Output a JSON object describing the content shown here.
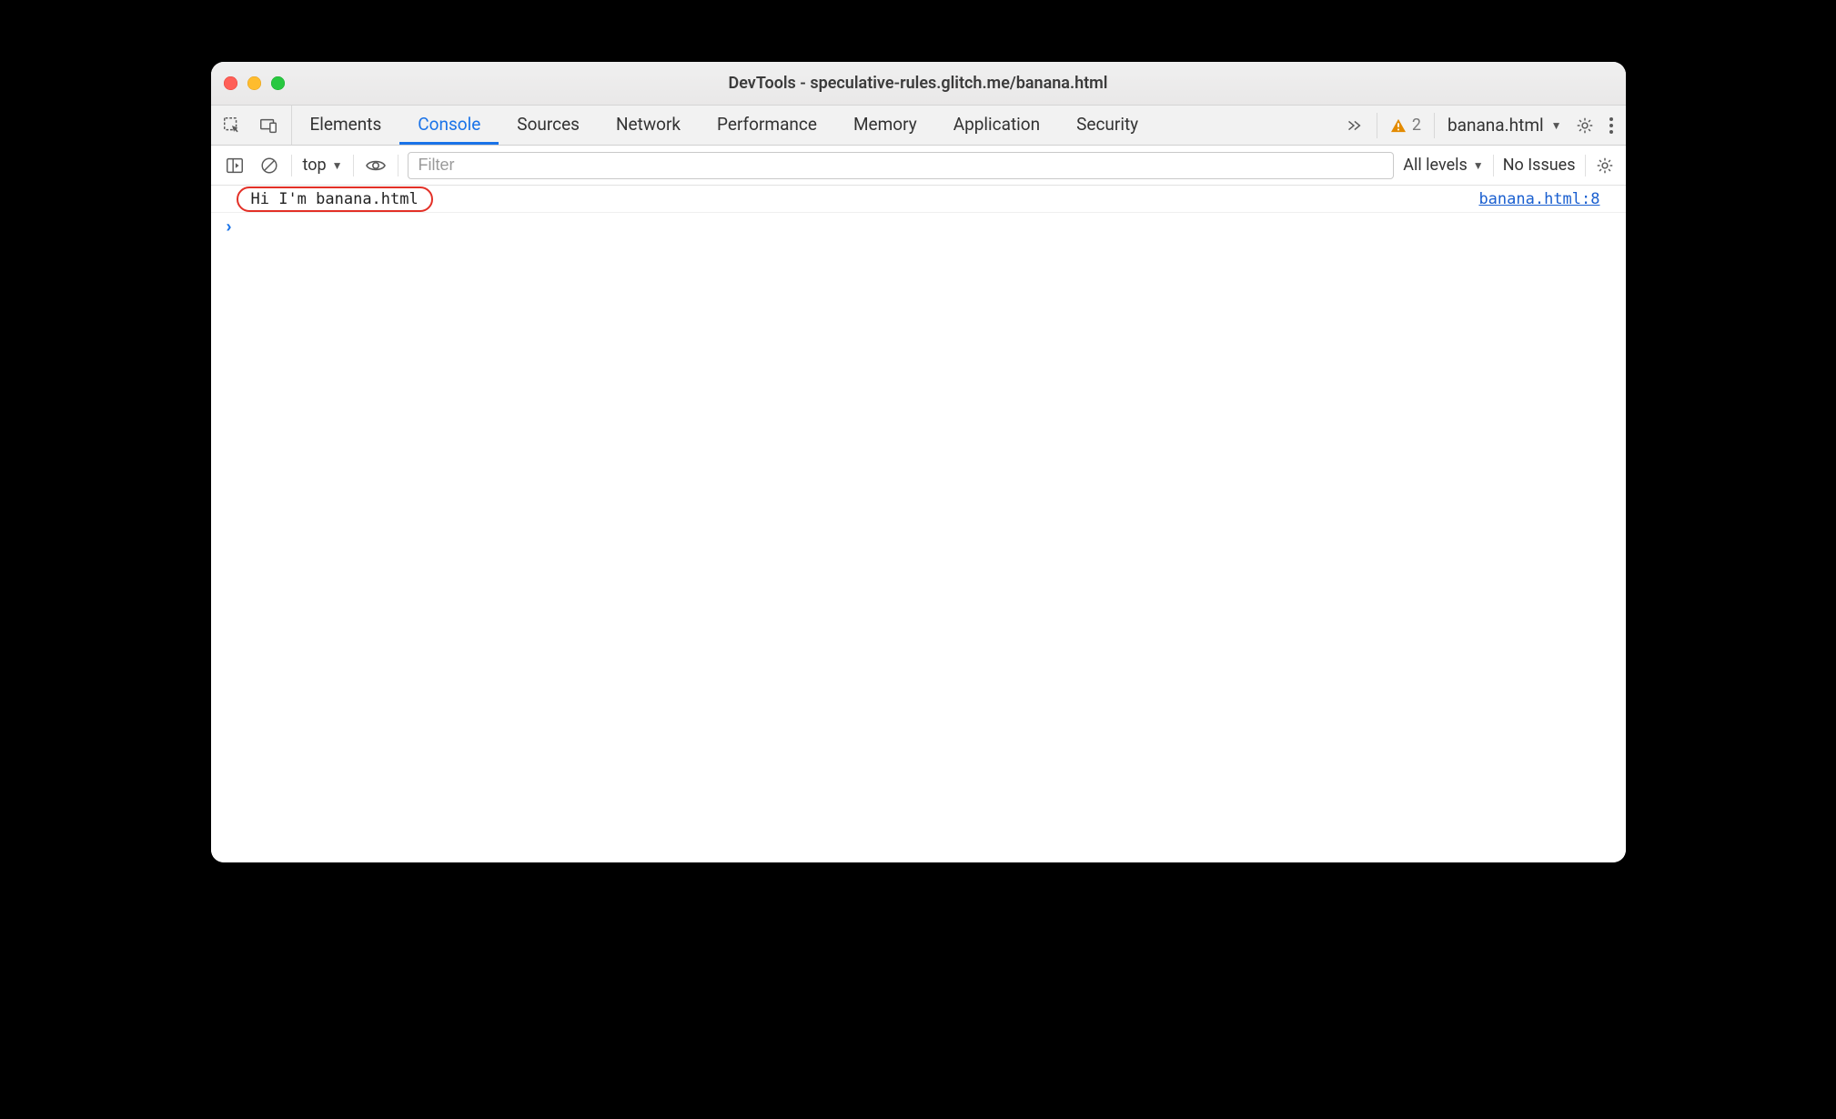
{
  "window": {
    "title": "DevTools - speculative-rules.glitch.me/banana.html"
  },
  "tabs": {
    "items": [
      "Elements",
      "Console",
      "Sources",
      "Network",
      "Performance",
      "Memory",
      "Application",
      "Security"
    ],
    "active_index": 1
  },
  "topbar": {
    "warning_count": "2",
    "target": "banana.html"
  },
  "console_toolbar": {
    "context": "top",
    "filter_placeholder": "Filter",
    "levels_label": "All levels",
    "issues_label": "No Issues"
  },
  "console": {
    "rows": [
      {
        "message": "Hi I'm banana.html",
        "source": "banana.html:8"
      }
    ]
  }
}
